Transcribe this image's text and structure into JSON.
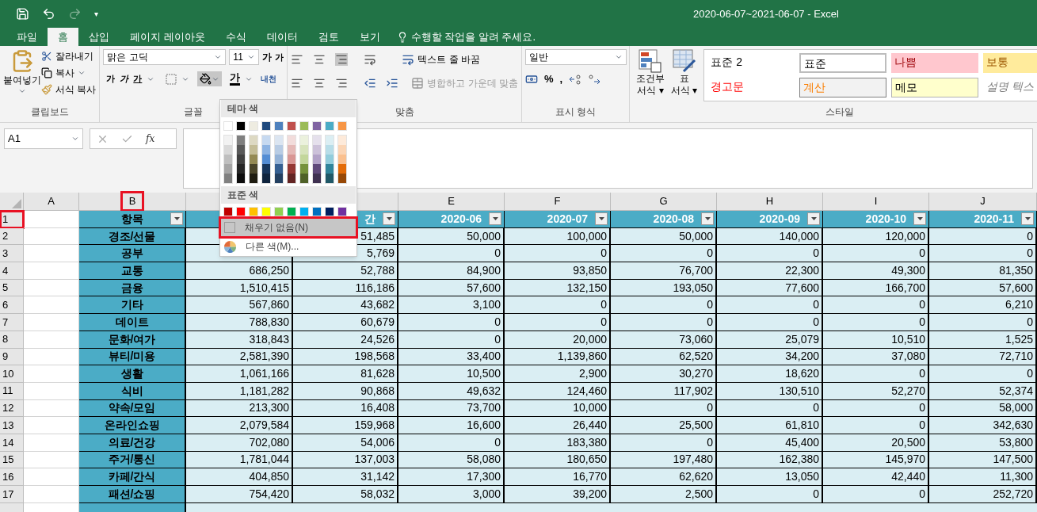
{
  "window": {
    "title": "2020-06-07~2021-06-07 - Excel"
  },
  "quick_access": {
    "customize": "▾"
  },
  "tabs": [
    {
      "label": "파일",
      "selected": false
    },
    {
      "label": "홈",
      "selected": true
    },
    {
      "label": "삽입",
      "selected": false
    },
    {
      "label": "페이지 레이아웃",
      "selected": false
    },
    {
      "label": "수식",
      "selected": false
    },
    {
      "label": "데이터",
      "selected": false
    },
    {
      "label": "검토",
      "selected": false
    },
    {
      "label": "보기",
      "selected": false
    }
  ],
  "tell_me": {
    "placeholder": "수행할 작업을 알려 주세요."
  },
  "clipboard": {
    "paste": "붙여넣기",
    "cut": "잘라내기",
    "copy": "복사",
    "format_painter": "서식 복사",
    "group": "클립보드"
  },
  "font": {
    "name": "맑은 고딕",
    "size": "11",
    "grow": "가",
    "shrink": "가",
    "bold": "가",
    "italic": "가",
    "underline": "가",
    "font_color": "가",
    "phonetic": "내천",
    "group": "글꼴"
  },
  "alignment": {
    "wrap": "텍스트 줄 바꿈",
    "merge": "병합하고 가운데 맞춤",
    "merge_disabled": true,
    "group": "맞춤"
  },
  "number": {
    "format": "일반",
    "percent": "%",
    "comma": ",",
    "group": "표시 형식"
  },
  "styles": {
    "conditional": [
      "조건부",
      "서식 ▾"
    ],
    "table": [
      "표",
      "서식 ▾"
    ],
    "group": "스타일",
    "cells": [
      {
        "label": "표준 2",
        "kind": "plain"
      },
      {
        "label": "표준",
        "kind": "selected"
      },
      {
        "label": "나쁨",
        "kind": "bad"
      },
      {
        "label": "보통",
        "kind": "neutral"
      },
      {
        "label": "경고문",
        "kind": "warning"
      },
      {
        "label": "계산",
        "kind": "calc"
      },
      {
        "label": "메모",
        "kind": "note"
      },
      {
        "label": "설명 텍스",
        "kind": "explanatory"
      }
    ]
  },
  "formula_bar": {
    "name_box": "A1",
    "fx": "fx"
  },
  "columns": {
    "A": {
      "letter": "A",
      "highlighted": false
    },
    "B": {
      "letter": "B",
      "highlighted": true
    },
    "E": {
      "letter": "E",
      "highlighted": false
    },
    "F": {
      "letter": "F",
      "highlighted": false
    },
    "G": {
      "letter": "G",
      "highlighted": false
    },
    "H": {
      "letter": "H",
      "highlighted": false
    },
    "I": {
      "letter": "I",
      "highlighted": false
    },
    "J": {
      "letter": "J",
      "highlighted": false
    }
  },
  "header_row": {
    "num": "1",
    "highlighted": true,
    "cells": {
      "B": "항목",
      "D": "간",
      "E": "2020-06",
      "F": "2020-07",
      "G": "2020-08",
      "H": "2020-09",
      "I": "2020-10",
      "J": "2020-11"
    }
  },
  "rows": [
    {
      "num": "2",
      "label": "경조/선물",
      "cells": {
        "D": "51,485",
        "E": "50,000",
        "F": "100,000",
        "G": "50,000",
        "H": "140,000",
        "I": "120,000",
        "J": "0"
      }
    },
    {
      "num": "3",
      "label": "공부",
      "cells": {
        "D": "5,769",
        "E": "0",
        "F": "0",
        "G": "0",
        "H": "0",
        "I": "0",
        "J": "0"
      }
    },
    {
      "num": "4",
      "label": "교통",
      "cells": {
        "C": "686,250",
        "D": "52,788",
        "E": "84,900",
        "F": "93,850",
        "G": "76,700",
        "H": "22,300",
        "I": "49,300",
        "J": "81,350"
      }
    },
    {
      "num": "5",
      "label": "금융",
      "cells": {
        "C": "1,510,415",
        "D": "116,186",
        "E": "57,600",
        "F": "132,150",
        "G": "193,050",
        "H": "77,600",
        "I": "166,700",
        "J": "57,600"
      }
    },
    {
      "num": "6",
      "label": "기타",
      "cells": {
        "C": "567,860",
        "D": "43,682",
        "E": "3,100",
        "F": "0",
        "G": "0",
        "H": "0",
        "I": "0",
        "J": "6,210"
      }
    },
    {
      "num": "7",
      "label": "데이트",
      "cells": {
        "C": "788,830",
        "D": "60,679",
        "E": "0",
        "F": "0",
        "G": "0",
        "H": "0",
        "I": "0",
        "J": "0"
      }
    },
    {
      "num": "8",
      "label": "문화/여가",
      "cells": {
        "C": "318,843",
        "D": "24,526",
        "E": "0",
        "F": "20,000",
        "G": "73,060",
        "H": "25,079",
        "I": "10,510",
        "J": "1,525"
      }
    },
    {
      "num": "9",
      "label": "뷰티/미용",
      "cells": {
        "C": "2,581,390",
        "D": "198,568",
        "E": "33,400",
        "F": "1,139,860",
        "G": "62,520",
        "H": "34,200",
        "I": "37,080",
        "J": "72,710"
      }
    },
    {
      "num": "10",
      "label": "생활",
      "cells": {
        "C": "1,061,166",
        "D": "81,628",
        "E": "10,500",
        "F": "2,900",
        "G": "30,270",
        "H": "18,620",
        "I": "0",
        "J": "0"
      }
    },
    {
      "num": "11",
      "label": "식비",
      "cells": {
        "C": "1,181,282",
        "D": "90,868",
        "E": "49,632",
        "F": "124,460",
        "G": "117,902",
        "H": "130,510",
        "I": "52,270",
        "J": "52,374"
      }
    },
    {
      "num": "12",
      "label": "약속/모임",
      "cells": {
        "C": "213,300",
        "D": "16,408",
        "E": "73,700",
        "F": "10,000",
        "G": "0",
        "H": "0",
        "I": "0",
        "J": "58,000"
      }
    },
    {
      "num": "13",
      "label": "온라인쇼핑",
      "cells": {
        "C": "2,079,584",
        "D": "159,968",
        "E": "16,600",
        "F": "26,440",
        "G": "25,500",
        "H": "61,810",
        "I": "0",
        "J": "342,630"
      }
    },
    {
      "num": "14",
      "label": "의료/건강",
      "cells": {
        "C": "702,080",
        "D": "54,006",
        "E": "0",
        "F": "183,380",
        "G": "0",
        "H": "45,400",
        "I": "20,500",
        "J": "53,800"
      }
    },
    {
      "num": "15",
      "label": "주거/통신",
      "cells": {
        "C": "1,781,044",
        "D": "137,003",
        "E": "58,080",
        "F": "180,650",
        "G": "197,480",
        "H": "162,380",
        "I": "145,970",
        "J": "147,500"
      }
    },
    {
      "num": "16",
      "label": "카페/간식",
      "cells": {
        "C": "404,850",
        "D": "31,142",
        "E": "17,300",
        "F": "16,770",
        "G": "62,620",
        "H": "13,050",
        "I": "42,440",
        "J": "11,300"
      }
    },
    {
      "num": "17",
      "label": "패션/쇼핑",
      "cells": {
        "C": "754,420",
        "D": "58,032",
        "E": "3,000",
        "F": "39,200",
        "G": "2,500",
        "H": "0",
        "I": "0",
        "J": "252,720"
      }
    }
  ],
  "fill_menu": {
    "theme_title": "테마 색",
    "standard_title": "표준 색",
    "theme_colors": [
      {
        "color": "#ffffff",
        "shades": [
          {
            "color": "#f2f2f2"
          },
          {
            "color": "#d9d9d9"
          },
          {
            "color": "#bfbfbf"
          },
          {
            "color": "#a6a6a6"
          },
          {
            "color": "#808080"
          }
        ]
      },
      {
        "color": "#000000",
        "shades": [
          {
            "color": "#7f7f7f"
          },
          {
            "color": "#595959"
          },
          {
            "color": "#404040"
          },
          {
            "color": "#262626"
          },
          {
            "color": "#0d0d0d"
          }
        ]
      },
      {
        "color": "#eeece1",
        "shades": [
          {
            "color": "#ddd9c3"
          },
          {
            "color": "#c4bd97"
          },
          {
            "color": "#948a54"
          },
          {
            "color": "#4a452a"
          },
          {
            "color": "#1e1c11"
          }
        ]
      },
      {
        "color": "#1f497d",
        "shades": [
          {
            "color": "#c6d9f0"
          },
          {
            "color": "#8db3e2"
          },
          {
            "color": "#548dd4"
          },
          {
            "color": "#17365d"
          },
          {
            "color": "#0f243e"
          }
        ]
      },
      {
        "color": "#4f81bd",
        "shades": [
          {
            "color": "#dbe5f1"
          },
          {
            "color": "#b8cce4"
          },
          {
            "color": "#95b3d7"
          },
          {
            "color": "#366092"
          },
          {
            "color": "#244061"
          }
        ]
      },
      {
        "color": "#c0504d",
        "shades": [
          {
            "color": "#f2dcdb"
          },
          {
            "color": "#e5b9b7"
          },
          {
            "color": "#d99694"
          },
          {
            "color": "#953734"
          },
          {
            "color": "#632423"
          }
        ]
      },
      {
        "color": "#9bbb59",
        "shades": [
          {
            "color": "#ebf1dd"
          },
          {
            "color": "#d7e3bc"
          },
          {
            "color": "#c3d69b"
          },
          {
            "color": "#76923c"
          },
          {
            "color": "#4f6128"
          }
        ]
      },
      {
        "color": "#8064a2",
        "shades": [
          {
            "color": "#e5e0ec"
          },
          {
            "color": "#ccc1d9"
          },
          {
            "color": "#b2a2c7"
          },
          {
            "color": "#5f497a"
          },
          {
            "color": "#3f3151"
          }
        ]
      },
      {
        "color": "#4bacc6",
        "shades": [
          {
            "color": "#dbeef3"
          },
          {
            "color": "#b7dde8"
          },
          {
            "color": "#92cddc"
          },
          {
            "color": "#31859b"
          },
          {
            "color": "#205867"
          }
        ]
      },
      {
        "color": "#f79646",
        "shades": [
          {
            "color": "#fdeada"
          },
          {
            "color": "#fbd5b5"
          },
          {
            "color": "#fac08f"
          },
          {
            "color": "#e36c09"
          },
          {
            "color": "#974806"
          }
        ]
      }
    ],
    "standard_colors": [
      {
        "color": "#c00000"
      },
      {
        "color": "#ff0000"
      },
      {
        "color": "#ffc000"
      },
      {
        "color": "#ffff00"
      },
      {
        "color": "#92d050"
      },
      {
        "color": "#00b050"
      },
      {
        "color": "#00b0f0"
      },
      {
        "color": "#0070c0"
      },
      {
        "color": "#002060"
      },
      {
        "color": "#7030a0"
      }
    ],
    "items": [
      {
        "label": "채우기 없음(N)",
        "kind": "no_fill",
        "highlighted": true
      },
      {
        "label": "다른 색(M)...",
        "kind": "more",
        "highlighted": false
      }
    ]
  }
}
